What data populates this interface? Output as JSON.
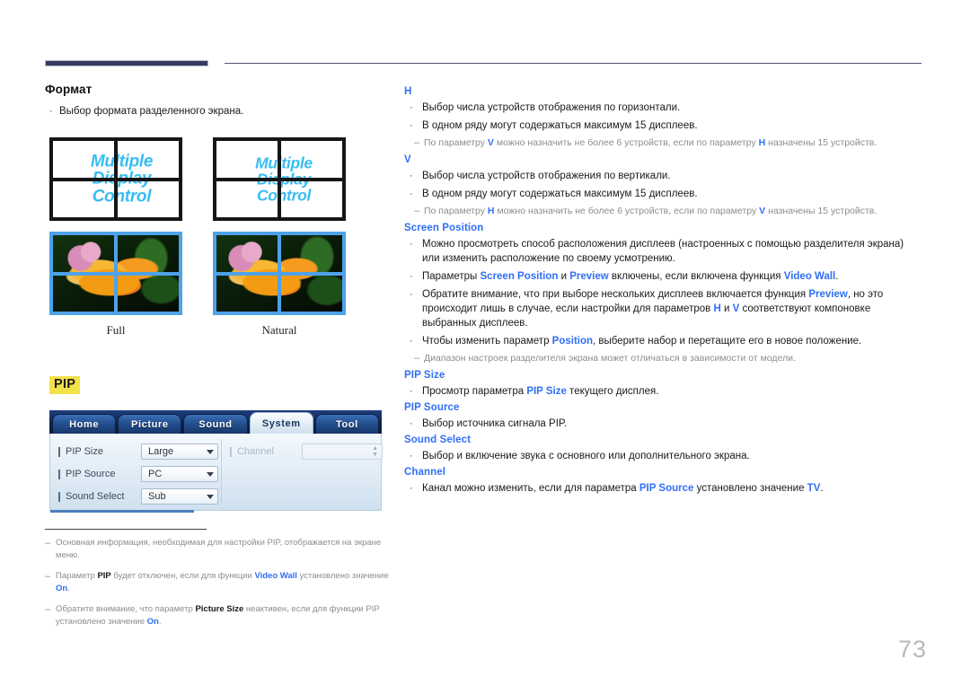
{
  "page": {
    "number": "73",
    "accent_blue": "#2f6ff5",
    "header_bar_color": "#343a5e",
    "badge_yellow": "#f2e24a"
  },
  "left": {
    "section_title": "Формат",
    "bullets": [
      "Выбор формата разделенного экрана."
    ],
    "displays": [
      {
        "wire_text_line1": "Multiple",
        "wire_text_line2": "Display",
        "wire_text_line3": "Control",
        "label": "Full"
      },
      {
        "wire_text_line1": "Multiple",
        "wire_text_line2": "Display",
        "wire_text_line3": "Control",
        "label": "Natural"
      }
    ],
    "pip_badge": "PIP",
    "osd": {
      "tabs": [
        {
          "label": "Home",
          "active": false
        },
        {
          "label": "Picture",
          "active": false
        },
        {
          "label": "Sound",
          "active": false
        },
        {
          "label": "System",
          "active": true
        },
        {
          "label": "Tool",
          "active": false
        }
      ],
      "rows": [
        {
          "label": "PIP Size",
          "value": "Large"
        },
        {
          "label": "PIP Source",
          "value": "PC"
        },
        {
          "label": "Sound Select",
          "value": "Sub"
        }
      ],
      "right_field": {
        "label": "Channel",
        "value": ""
      }
    },
    "footnotes": [
      {
        "dash": "‒",
        "parts": [
          {
            "t": "Основная информация, необходимая для настройки PIP, отображается на экране меню.",
            "s": "n"
          }
        ]
      },
      {
        "dash": "‒",
        "parts": [
          {
            "t": "Параметр ",
            "s": "n"
          },
          {
            "t": "PIP",
            "s": "d"
          },
          {
            "t": " будет отключен, если для функции ",
            "s": "n"
          },
          {
            "t": "Video Wall",
            "s": "b"
          },
          {
            "t": " установлено значение ",
            "s": "n"
          },
          {
            "t": "On",
            "s": "b"
          },
          {
            "t": ".",
            "s": "n"
          }
        ]
      },
      {
        "dash": "‒",
        "parts": [
          {
            "t": "Обратите внимание, что параметр ",
            "s": "n"
          },
          {
            "t": "Picture Size",
            "s": "d"
          },
          {
            "t": " неактивен, если для функции PIP установлено значение ",
            "s": "n"
          },
          {
            "t": "On",
            "s": "b"
          },
          {
            "t": ".",
            "s": "n"
          }
        ]
      }
    ]
  },
  "right": {
    "blocks": [
      {
        "heading": "H",
        "items": [
          {
            "type": "bullet",
            "parts": [
              {
                "t": "Выбор числа устройств отображения по горизонтали.",
                "s": "n"
              }
            ]
          },
          {
            "type": "bullet",
            "parts": [
              {
                "t": "В одном ряду могут содержаться максимум 15 дисплеев.",
                "s": "n"
              }
            ]
          },
          {
            "type": "note",
            "parts": [
              {
                "t": "По параметру ",
                "s": "n"
              },
              {
                "t": "V",
                "s": "b"
              },
              {
                "t": " можно назначить не более 6 устройств, если по параметру ",
                "s": "n"
              },
              {
                "t": "H",
                "s": "b"
              },
              {
                "t": " назначены 15 устройств.",
                "s": "n"
              }
            ]
          }
        ]
      },
      {
        "heading": "V",
        "items": [
          {
            "type": "bullet",
            "parts": [
              {
                "t": "Выбор числа устройств отображения по вертикали.",
                "s": "n"
              }
            ]
          },
          {
            "type": "bullet",
            "parts": [
              {
                "t": "В одном ряду могут содержаться максимум 15 дисплеев.",
                "s": "n"
              }
            ]
          },
          {
            "type": "note",
            "parts": [
              {
                "t": "По параметру ",
                "s": "n"
              },
              {
                "t": "H",
                "s": "b"
              },
              {
                "t": " можно назначить не более 6 устройств, если по параметру ",
                "s": "n"
              },
              {
                "t": "V",
                "s": "b"
              },
              {
                "t": " назначены 15 устройств.",
                "s": "n"
              }
            ]
          }
        ]
      },
      {
        "heading": "Screen Position",
        "items": [
          {
            "type": "bullet",
            "parts": [
              {
                "t": "Можно просмотреть способ расположения дисплеев (настроенных с помощью разделителя экрана) или изменить расположение по своему усмотрению.",
                "s": "n"
              }
            ]
          },
          {
            "type": "bullet",
            "parts": [
              {
                "t": "Параметры ",
                "s": "n"
              },
              {
                "t": "Screen Position",
                "s": "b"
              },
              {
                "t": " и ",
                "s": "n"
              },
              {
                "t": "Preview",
                "s": "b"
              },
              {
                "t": " включены, если включена функция ",
                "s": "n"
              },
              {
                "t": "Video Wall",
                "s": "b"
              },
              {
                "t": ".",
                "s": "n"
              }
            ]
          },
          {
            "type": "bullet",
            "parts": [
              {
                "t": "Обратите внимание, что при выборе нескольких дисплеев включается функция ",
                "s": "n"
              },
              {
                "t": "Preview",
                "s": "b"
              },
              {
                "t": ", но это происходит лишь в случае, если настройки для параметров ",
                "s": "n"
              },
              {
                "t": "H",
                "s": "b"
              },
              {
                "t": " и ",
                "s": "n"
              },
              {
                "t": "V",
                "s": "b"
              },
              {
                "t": " соответствуют компоновке выбранных дисплеев.",
                "s": "n"
              }
            ]
          },
          {
            "type": "bullet",
            "parts": [
              {
                "t": "Чтобы изменить параметр ",
                "s": "n"
              },
              {
                "t": "Position",
                "s": "b"
              },
              {
                "t": ", выберите набор и перетащите его в новое положение.",
                "s": "n"
              }
            ]
          },
          {
            "type": "note",
            "parts": [
              {
                "t": "Диапазон настроек разделителя экрана может отличаться в зависимости от модели.",
                "s": "n"
              }
            ]
          }
        ]
      },
      {
        "heading": "PIP Size",
        "items": [
          {
            "type": "bullet",
            "parts": [
              {
                "t": "Просмотр параметра ",
                "s": "n"
              },
              {
                "t": "PIP Size",
                "s": "b"
              },
              {
                "t": " текущего дисплея.",
                "s": "n"
              }
            ]
          }
        ]
      },
      {
        "heading": "PIP Source",
        "items": [
          {
            "type": "bullet",
            "parts": [
              {
                "t": "Выбор источника сигнала PIP.",
                "s": "n"
              }
            ]
          }
        ]
      },
      {
        "heading": "Sound Select",
        "items": [
          {
            "type": "bullet",
            "parts": [
              {
                "t": "Выбор и включение звука с основного или дополнительного экрана.",
                "s": "n"
              }
            ]
          }
        ]
      },
      {
        "heading": "Channel",
        "items": [
          {
            "type": "bullet",
            "parts": [
              {
                "t": "Канал можно изменить, если для параметра ",
                "s": "n"
              },
              {
                "t": "PIP Source",
                "s": "b"
              },
              {
                "t": " установлено значение ",
                "s": "n"
              },
              {
                "t": "TV",
                "s": "b"
              },
              {
                "t": ".",
                "s": "n"
              }
            ]
          }
        ]
      }
    ]
  }
}
